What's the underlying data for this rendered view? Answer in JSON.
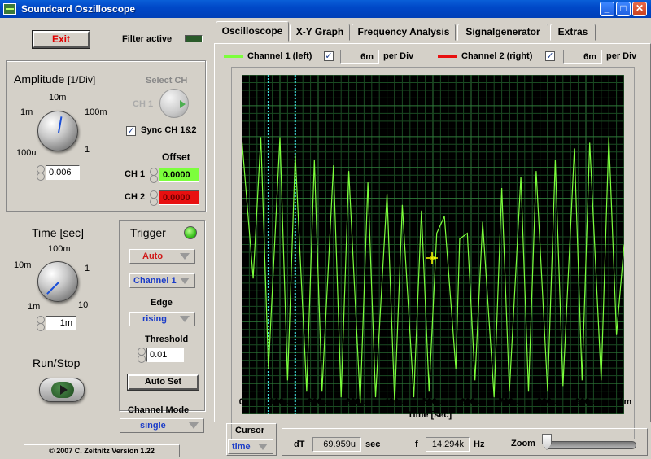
{
  "window": {
    "title": "Soundcard Oszilloscope",
    "minimize_icon": "minimize-icon",
    "maximize_icon": "maximize-icon",
    "close_icon": "close-icon"
  },
  "controls": {
    "exit_label": "Exit",
    "filter_label": "Filter active",
    "amplitude": {
      "title": "Amplitude",
      "unit": "[1/Div]",
      "ticks": [
        "1m",
        "10m",
        "100m",
        "100u",
        "1"
      ],
      "value": "0.006"
    },
    "select_ch": {
      "title": "Select CH",
      "value": "CH 1",
      "sync_label": "Sync CH 1&2",
      "sync_checked": true
    },
    "offset": {
      "title": "Offset",
      "ch1_label": "CH 1",
      "ch1_value": "0.0000",
      "ch2_label": "CH 2",
      "ch2_value": "0.0000",
      "ch1_color": "#7cff3c",
      "ch2_color": "#e81010"
    },
    "time": {
      "title": "Time [sec]",
      "ticks": [
        "10m",
        "100m",
        "1",
        "1m",
        "10"
      ],
      "value": "1m"
    },
    "trigger": {
      "title": "Trigger",
      "mode": "Auto",
      "channel": "Channel 1",
      "edge_label": "Edge",
      "edge": "rising",
      "threshold_label": "Threshold",
      "threshold": "0.01",
      "autoset_label": "Auto Set"
    },
    "run_stop_label": "Run/Stop",
    "channel_mode": {
      "label": "Channel Mode",
      "value": "single"
    },
    "copyright": "© 2007  C. Zeitnitz Version 1.22"
  },
  "tabs": [
    {
      "label": "Oscilloscope",
      "active": true
    },
    {
      "label": "X-Y Graph",
      "active": false
    },
    {
      "label": "Frequency Analysis",
      "active": false
    },
    {
      "label": "Signalgenerator",
      "active": false
    },
    {
      "label": "Extras",
      "active": false
    }
  ],
  "scope": {
    "ch1_label": "Channel 1 (left)",
    "ch1_div": "6m",
    "ch2_label": "Channel 2 (right)",
    "ch2_div": "6m",
    "per_div": "per Div",
    "ch1_enabled": true,
    "ch2_enabled": true,
    "ch1_color": "#7cff3c",
    "ch2_color": "#e81010",
    "xaxis_title": "Time [sec]",
    "xticks": [
      "0",
      "100u",
      "200u",
      "300u",
      "400u",
      "500u",
      "600u",
      "700u",
      "800u",
      "900u",
      "1m"
    ]
  },
  "chart_data": {
    "type": "line",
    "xlabel": "Time [sec]",
    "xlim": [
      0,
      0.001
    ],
    "x_tick_labels": [
      "0",
      "100u",
      "200u",
      "300u",
      "400u",
      "500u",
      "600u",
      "700u",
      "800u",
      "900u",
      "1m"
    ],
    "grid": true,
    "cursors_x": [
      7e-05,
      0.00014
    ],
    "series": [
      {
        "name": "Channel 1 (left)",
        "color": "#7cff3c",
        "x": [
          0.0,
          3e-05,
          5e-05,
          7e-05,
          0.0001,
          0.00012,
          0.00014,
          0.00017,
          0.00019,
          0.00021,
          0.00024,
          0.00026,
          0.00028,
          0.00031,
          0.00033,
          0.00035,
          0.00038,
          0.0004,
          0.00042,
          0.00045,
          0.00047,
          0.00049,
          0.00051,
          0.00053,
          0.00056,
          0.00057,
          0.00059,
          0.00061,
          0.00063,
          0.00066,
          0.00068,
          0.0007,
          0.00073,
          0.00075,
          0.00077,
          0.0008,
          0.00082,
          0.00084,
          0.00087,
          0.00089,
          0.00091,
          0.00094,
          0.00096,
          0.00098,
          0.001
        ],
        "y": [
          0.95,
          -0.3,
          0.95,
          -1.1,
          0.95,
          -1.2,
          0.8,
          -1.3,
          0.75,
          -1.3,
          0.7,
          -1.35,
          0.65,
          -1.4,
          0.55,
          -1.35,
          0.45,
          -1.4,
          0.35,
          -1.35,
          0.3,
          -1.3,
          0.1,
          0.25,
          -1.1,
          0.05,
          0.1,
          -1.2,
          0.2,
          -1.35,
          0.5,
          -1.3,
          0.6,
          -1.3,
          0.65,
          -1.3,
          0.75,
          -1.25,
          0.85,
          -1.2,
          0.9,
          -1.2,
          0.95,
          -0.8,
          0.0
        ]
      }
    ]
  },
  "cursor": {
    "title": "Cursor",
    "mode": "time",
    "dt_label": "dT",
    "dt_value": "69.959u",
    "dt_unit": "sec",
    "f_label": "f",
    "f_value": "14.294k",
    "f_unit": "Hz",
    "zoom_label": "Zoom",
    "zoom_level": 0.0
  }
}
